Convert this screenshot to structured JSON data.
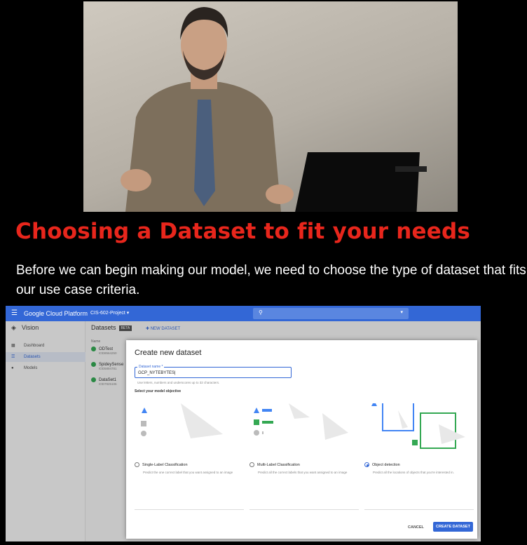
{
  "slide": {
    "title": "Choosing a Dataset to fit your needs",
    "description": "Before we can begin making our model, we need to choose the type of dataset that fits our use case criteria."
  },
  "gcp": {
    "menu_icon": "hamburger-icon",
    "brand": "Google Cloud Platform",
    "project": "CIS-602-Project ▾",
    "sidebar": {
      "product": "Vision",
      "items": [
        {
          "label": "Dashboard",
          "icon": "dashboard-icon"
        },
        {
          "label": "Datasets",
          "icon": "list-icon",
          "active": true
        },
        {
          "label": "Models",
          "icon": "bulb-icon"
        }
      ]
    },
    "content": {
      "heading": "Datasets",
      "badge": "BETA",
      "new_dataset": "NEW DATASET",
      "col_name": "Name",
      "rows": [
        {
          "name": "ODTest",
          "id": "IOD8564250"
        },
        {
          "name": "SpideySense",
          "id": "IOD5894781"
        },
        {
          "name": "DataSet1",
          "id": "IOD7925106"
        }
      ]
    },
    "dialog": {
      "title": "Create new dataset",
      "field_label": "Dataset name *",
      "field_value": "GCP_NYTEBYTES|",
      "hint": "Use letters, numbers and underscores up to 32 characters.",
      "objective_label": "Select your model objective",
      "options": [
        {
          "label": "Single-Label Classification",
          "desc": "Predict the one correct label that you want assigned to an image",
          "selected": false
        },
        {
          "label": "Multi-Label Classification",
          "desc": "Predict all the correct labels that you want assigned to an image",
          "selected": false
        },
        {
          "label": "Object detection",
          "desc": "Predict all the locations of objects that you're interested in.",
          "selected": true
        }
      ],
      "cancel": "CANCEL",
      "create": "CREATE DATASET"
    }
  },
  "colors": {
    "title_red": "#e8261c",
    "gcp_blue": "#3367d6"
  }
}
